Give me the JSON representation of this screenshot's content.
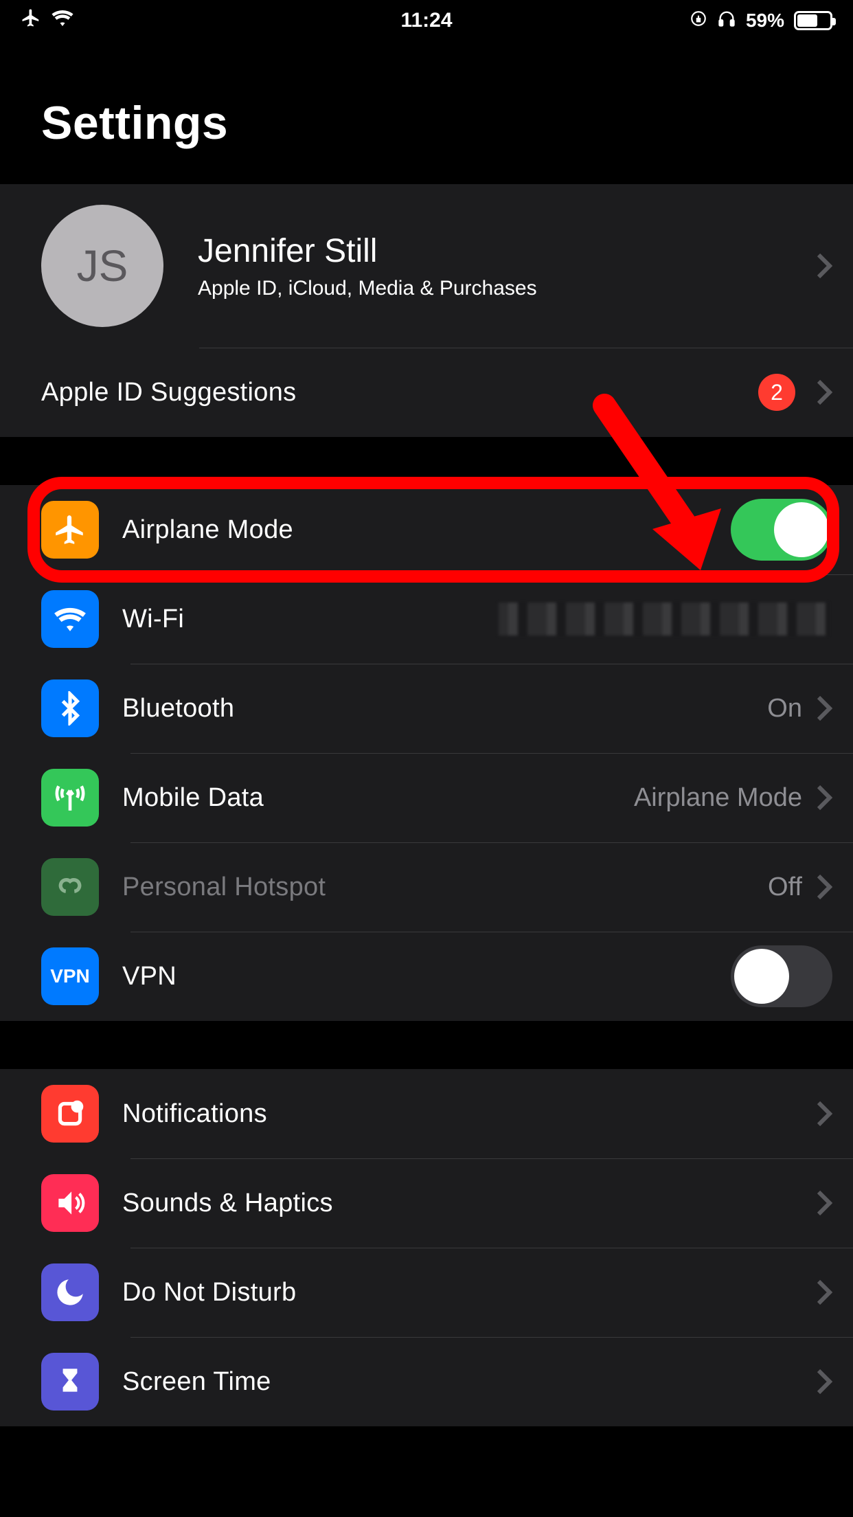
{
  "status": {
    "time": "11:24",
    "battery_pct": "59%"
  },
  "title": "Settings",
  "account": {
    "initials": "JS",
    "name": "Jennifer Still",
    "subtitle": "Apple ID, iCloud, Media & Purchases",
    "suggestions_label": "Apple ID Suggestions",
    "suggestions_badge": "2"
  },
  "connectivity": {
    "airplane": {
      "label": "Airplane Mode",
      "on": true,
      "color": "#ff9500"
    },
    "wifi": {
      "label": "Wi-Fi",
      "color": "#007aff"
    },
    "bluetooth": {
      "label": "Bluetooth",
      "value": "On",
      "color": "#007aff"
    },
    "mobile_data": {
      "label": "Mobile Data",
      "value": "Airplane Mode",
      "color": "#34c759"
    },
    "hotspot": {
      "label": "Personal Hotspot",
      "value": "Off",
      "color": "#2f6b3a",
      "disabled": true
    },
    "vpn": {
      "label": "VPN",
      "on": false,
      "color": "#007aff",
      "icon_text": "VPN"
    }
  },
  "general": {
    "notifications": {
      "label": "Notifications",
      "color": "#ff3b30"
    },
    "sounds": {
      "label": "Sounds & Haptics",
      "color": "#ff2d55"
    },
    "dnd": {
      "label": "Do Not Disturb",
      "color": "#5856d6"
    },
    "screen_time": {
      "label": "Screen Time",
      "color": "#5856d6"
    }
  }
}
